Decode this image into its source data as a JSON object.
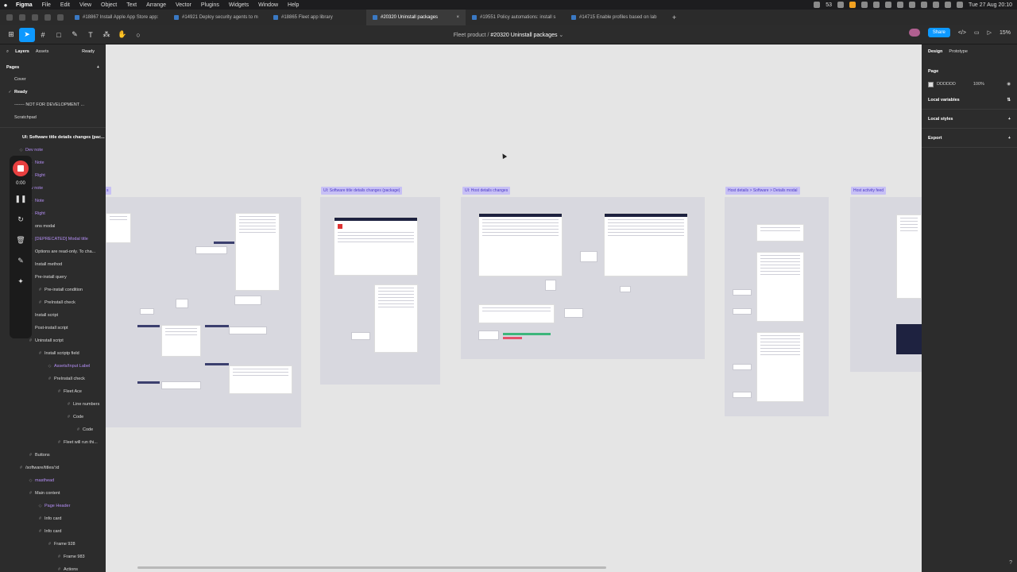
{
  "menubar": {
    "app": "Figma",
    "items": [
      "File",
      "Edit",
      "View",
      "Object",
      "Text",
      "Arrange",
      "Vector",
      "Plugins",
      "Widgets",
      "Window",
      "Help"
    ],
    "battery_count": "53",
    "clock": "Tue 27 Aug  20:10"
  },
  "tabs": [
    {
      "label": "#18867 Install Apple App Store app:"
    },
    {
      "label": "#14921 Deploy security agents to m"
    },
    {
      "label": "#18865 Fleet app library"
    },
    {
      "label": "#20320 Uninstall packages",
      "active": true
    },
    {
      "label": "#19551 Policy automations: install s"
    },
    {
      "label": "#14715 Enable profiles based on lab"
    }
  ],
  "toolbar": {
    "project": "Fleet product",
    "separator": "/",
    "file": "#20320 Uninstall packages",
    "share": "Share",
    "zoom": "15%"
  },
  "left_panel": {
    "tab_layers": "Layers",
    "tab_assets": "Assets",
    "status": "Ready",
    "pages_title": "Pages",
    "pages": [
      {
        "label": "Cover"
      },
      {
        "label": "Ready",
        "current": true
      },
      {
        "label": "------- NOT FOR DEVELOPMENT ..."
      },
      {
        "label": "Scratchpad"
      }
    ],
    "layers": [
      {
        "label": "UI: Software title details changes (pac...",
        "indent": 0,
        "style": "hl"
      },
      {
        "label": "Dev note",
        "indent": 1,
        "style": "purple"
      },
      {
        "label": "Note",
        "indent": 2,
        "style": "purple"
      },
      {
        "label": "Right",
        "indent": 2,
        "style": "purple"
      },
      {
        "label": "Dev note",
        "indent": 1,
        "style": "purple"
      },
      {
        "label": "Note",
        "indent": 2,
        "style": "purple"
      },
      {
        "label": "Right",
        "indent": 2,
        "style": "purple"
      },
      {
        "label": "ons modal",
        "indent": 2,
        "style": "plain"
      },
      {
        "label": "[DEPRECATED] Modal title",
        "indent": 2,
        "style": "purple"
      },
      {
        "label": "Options are read-only. To cha...",
        "indent": 2,
        "style": "plain"
      },
      {
        "label": "Install method",
        "indent": 2,
        "style": "plain"
      },
      {
        "label": "Pre-install query",
        "indent": 2,
        "style": "plain"
      },
      {
        "label": "Pre-install condition",
        "indent": 3,
        "style": "plain"
      },
      {
        "label": "PreInstall check",
        "indent": 3,
        "style": "plain"
      },
      {
        "label": "Install script",
        "indent": 2,
        "style": "plain"
      },
      {
        "label": "Post-install script",
        "indent": 2,
        "style": "plain"
      },
      {
        "label": "Uninstall script",
        "indent": 2,
        "style": "plain"
      },
      {
        "label": "Install scriptp field",
        "indent": 3,
        "style": "plain"
      },
      {
        "label": "Assets/Input Label",
        "indent": 4,
        "style": "purple"
      },
      {
        "label": "PreInstall check",
        "indent": 4,
        "style": "plain"
      },
      {
        "label": "Fleet Ace",
        "indent": 5,
        "style": "plain"
      },
      {
        "label": "Line numbers",
        "indent": 6,
        "style": "plain"
      },
      {
        "label": "Code",
        "indent": 6,
        "style": "plain"
      },
      {
        "label": "Code",
        "indent": 7,
        "style": "plain"
      },
      {
        "label": "Fleet will run thi...",
        "indent": 5,
        "style": "plain"
      },
      {
        "label": "Buttons",
        "indent": 2,
        "style": "plain"
      },
      {
        "label": "/software/titles/:id",
        "indent": 1,
        "style": "plain"
      },
      {
        "label": "masthead",
        "indent": 2,
        "style": "purple"
      },
      {
        "label": "Main content",
        "indent": 2,
        "style": "plain"
      },
      {
        "label": "Page Header",
        "indent": 3,
        "style": "purple"
      },
      {
        "label": "Info card",
        "indent": 3,
        "style": "plain"
      },
      {
        "label": "Info card",
        "indent": 3,
        "style": "plain"
      },
      {
        "label": "Frame 928",
        "indent": 4,
        "style": "plain"
      },
      {
        "label": "Frame 983",
        "indent": 5,
        "style": "plain"
      },
      {
        "label": "Actions",
        "indent": 5,
        "style": "plain"
      }
    ]
  },
  "recorder": {
    "time": "0:00"
  },
  "canvas": {
    "frame_labels": [
      {
        "text": "s"
      },
      {
        "text": "UI: Software title details changes (package)"
      },
      {
        "text": "UI: Host details changes"
      },
      {
        "text": "Host details > Software > Details modal"
      },
      {
        "text": "Host activity feed"
      }
    ]
  },
  "right_panel": {
    "tab_design": "Design",
    "tab_prototype": "Prototype",
    "page_title": "Page",
    "page_color": "DDDDDD",
    "page_opacity": "100%",
    "local_variables": "Local variables",
    "local_styles": "Local styles",
    "export": "Export"
  },
  "colors": {
    "accent": "#0d99ff",
    "frame_label_bg": "#c7c0f5",
    "frame_label_text": "#4a37c6",
    "record": "#e84040"
  }
}
